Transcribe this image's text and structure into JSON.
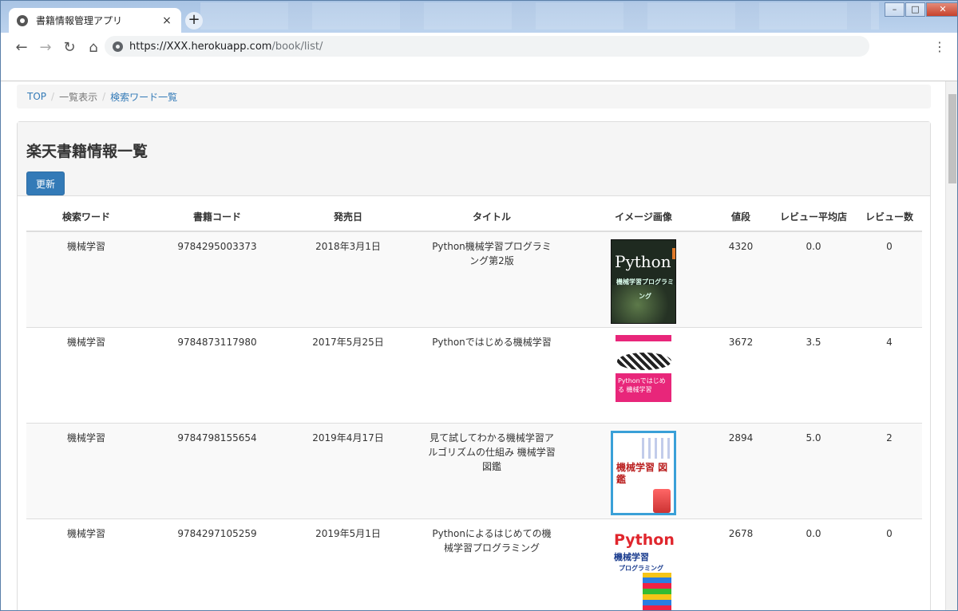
{
  "browser": {
    "tab_title": "書籍情報管理アプリ",
    "tab_close": "×",
    "new_tab": "+",
    "url_host": "https://XXX.herokuapp.com",
    "url_path": "/book/list/",
    "menu": "⋮",
    "window_controls": {
      "minimize": "–",
      "maximize": "□",
      "close": "✕"
    }
  },
  "breadcrumb": {
    "items": [
      "TOP",
      "一覧表示",
      "検索ワード一覧"
    ],
    "separator": "/"
  },
  "page": {
    "heading": "楽天書籍情報一覧",
    "update_button": "更新"
  },
  "table": {
    "headers": [
      "検索ワード",
      "書籍コード",
      "発売日",
      "タイトル",
      "イメージ画像",
      "値段",
      "レビュー平均店",
      "レビュー数"
    ],
    "rows": [
      {
        "keyword": "機械学習",
        "code": "9784295003373",
        "date": "2018年3月1日",
        "title": "Python機械学習プログラミング第2版",
        "price": "4320",
        "review_avg": "0.0",
        "review_count": "0",
        "cover": {
          "main": "Python",
          "sub": "機械学習プログラミング",
          "color": "#1f2a20"
        }
      },
      {
        "keyword": "機械学習",
        "code": "9784873117980",
        "date": "2017年5月25日",
        "title": "Pythonではじめる機械学習",
        "price": "3672",
        "review_avg": "3.5",
        "review_count": "4",
        "cover": {
          "main": "Pythonではじめる 機械学習",
          "color": "#e8267a"
        }
      },
      {
        "keyword": "機械学習",
        "code": "9784798155654",
        "date": "2019年4月17日",
        "title": "見て試してわかる機械学習アルゴリズムの仕組み 機械学習図鑑",
        "price": "2894",
        "review_avg": "5.0",
        "review_count": "2",
        "cover": {
          "main": "機械学習 図鑑",
          "color": "#3aa0d8"
        }
      },
      {
        "keyword": "機械学習",
        "code": "9784297105259",
        "date": "2019年5月1日",
        "title": "Pythonによるはじめての機械学習プログラミング",
        "price": "2678",
        "review_avg": "0.0",
        "review_count": "0",
        "cover": {
          "main": "Python",
          "sub": "機械学習",
          "sub2": "プログラミング",
          "color": "#e0262d"
        }
      }
    ]
  }
}
